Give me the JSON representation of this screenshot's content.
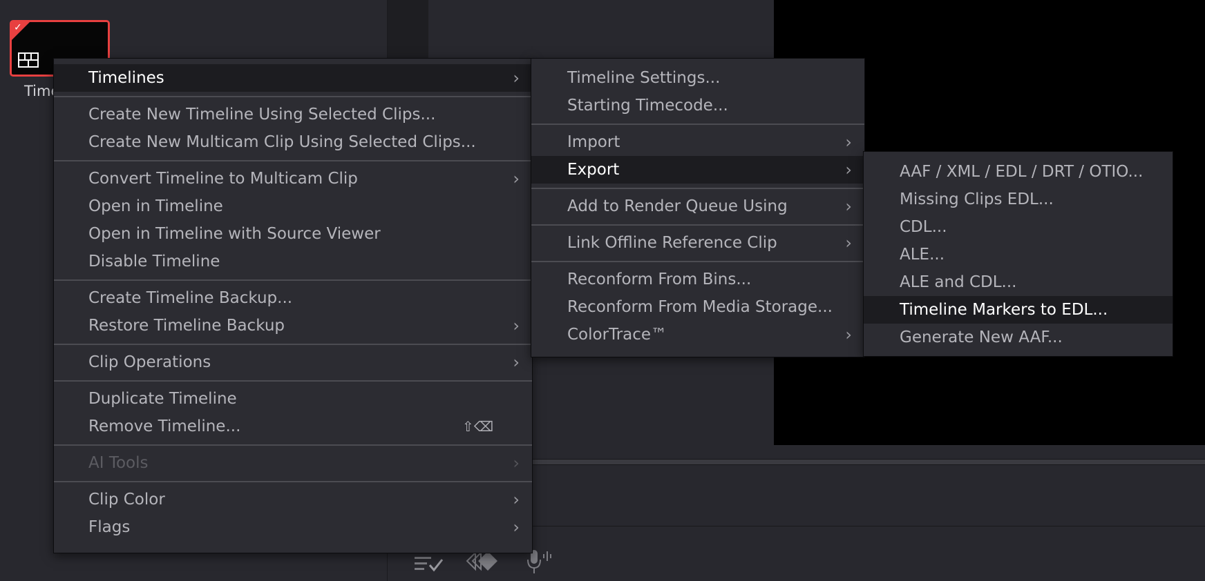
{
  "thumbnail": {
    "label": "Time",
    "icon": "timeline-icon",
    "check_icon": "checkmark-icon",
    "border_color": "#e84040"
  },
  "menu1": {
    "groups": [
      [
        {
          "label": "Timelines",
          "submenu": true,
          "active": true
        }
      ],
      [
        {
          "label": "Create New Timeline Using Selected Clips..."
        },
        {
          "label": "Create New Multicam Clip Using Selected Clips..."
        }
      ],
      [
        {
          "label": "Convert Timeline to Multicam Clip",
          "submenu": true
        },
        {
          "label": "Open in Timeline"
        },
        {
          "label": "Open in Timeline with Source Viewer"
        },
        {
          "label": "Disable Timeline"
        }
      ],
      [
        {
          "label": "Create Timeline Backup..."
        },
        {
          "label": "Restore Timeline Backup",
          "submenu": true
        }
      ],
      [
        {
          "label": "Clip Operations",
          "submenu": true
        }
      ],
      [
        {
          "label": "Duplicate Timeline"
        },
        {
          "label": "Remove Timeline...",
          "shortcut": "⇧⌫"
        }
      ],
      [
        {
          "label": "AI Tools",
          "submenu": true,
          "disabled": true
        }
      ],
      [
        {
          "label": "Clip Color",
          "submenu": true
        },
        {
          "label": "Flags",
          "submenu": true
        }
      ]
    ]
  },
  "menu2": {
    "groups": [
      [
        {
          "label": "Timeline Settings..."
        },
        {
          "label": "Starting Timecode..."
        }
      ],
      [
        {
          "label": "Import",
          "submenu": true
        },
        {
          "label": "Export",
          "submenu": true,
          "active": true
        }
      ],
      [
        {
          "label": "Add to Render Queue Using",
          "submenu": true
        }
      ],
      [
        {
          "label": "Link Offline Reference Clip",
          "submenu": true
        }
      ],
      [
        {
          "label": "Reconform From Bins..."
        },
        {
          "label": "Reconform From Media Storage..."
        },
        {
          "label": "ColorTrace™",
          "submenu": true
        }
      ]
    ]
  },
  "menu3": {
    "groups": [
      [
        {
          "label": "AAF / XML / EDL / DRT / OTIO..."
        },
        {
          "label": "Missing Clips EDL..."
        },
        {
          "label": "CDL..."
        },
        {
          "label": "ALE..."
        },
        {
          "label": "ALE and CDL..."
        },
        {
          "label": "Timeline Markers to EDL...",
          "active": true
        },
        {
          "label": "Generate New AAF..."
        }
      ]
    ]
  },
  "toolbar": {
    "icons": [
      "edit-index-icon",
      "markers-icon",
      "voiceover-mic-icon"
    ]
  },
  "colors": {
    "menu_bg": "#2c2c32",
    "active_bg": "#1c1c20",
    "text": "#b5b5bb",
    "active_text": "#ffffff",
    "accent": "#e84040"
  }
}
